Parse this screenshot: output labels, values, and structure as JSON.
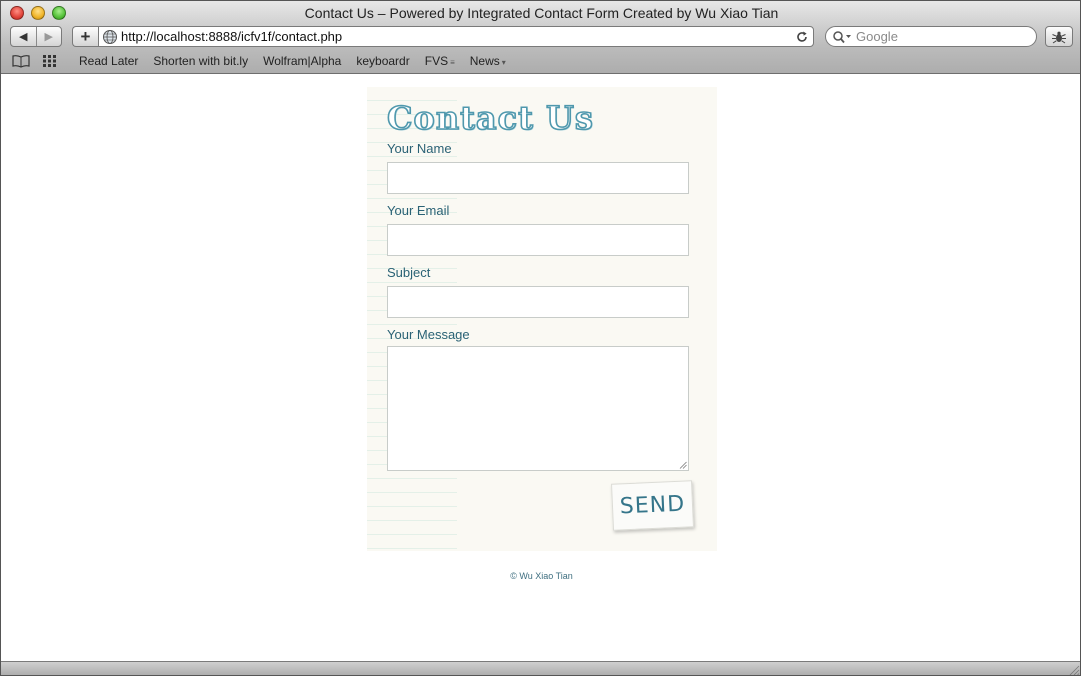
{
  "window": {
    "title": "Contact Us – Powered by Integrated Contact Form Created by Wu Xiao Tian"
  },
  "toolbar": {
    "back_label": "◀",
    "forward_label": "▶",
    "add_label": "+",
    "url": "http://localhost:8888/icfv1f/contact.php",
    "search_placeholder": "Google"
  },
  "bookmarks": {
    "items": [
      {
        "label": "Read Later"
      },
      {
        "label": "Shorten with bit.ly"
      },
      {
        "label": "Wolfram|Alpha"
      },
      {
        "label": "keyboardr"
      },
      {
        "label": "FVS",
        "suffix": "≡"
      },
      {
        "label": "News",
        "suffix": "▾"
      }
    ]
  },
  "form": {
    "heading": "Contact Us",
    "name_label": "Your Name",
    "email_label": "Your Email",
    "subject_label": "Subject",
    "message_label": "Your Message",
    "name_value": "",
    "email_value": "",
    "subject_value": "",
    "message_value": "",
    "send_label": "SEND"
  },
  "footer": {
    "text": "© Wu Xiao Tian"
  },
  "colors": {
    "accent": "#2a6275",
    "heading_stroke": "#4f98ad",
    "card_bg": "#faf9f3"
  },
  "icons": {
    "globe": "globe-icon",
    "reload": "reload-icon",
    "search": "search-icon",
    "bug": "bug-icon",
    "reading_list": "book-icon",
    "top_sites": "grid-icon"
  }
}
